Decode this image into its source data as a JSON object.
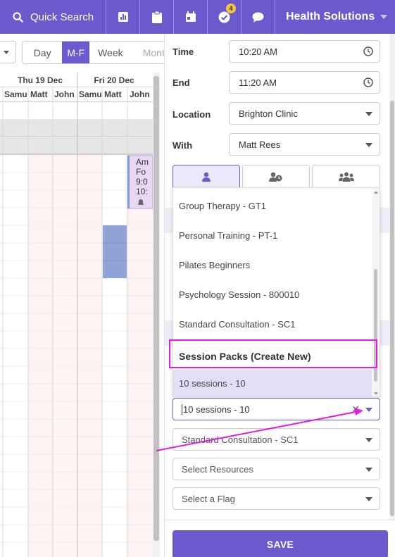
{
  "topbar": {
    "search_label": "Quick Search",
    "badge_count": "4",
    "org_name": "Health Solutions",
    "icons": [
      "search-icon",
      "chart-icon",
      "clipboard-icon",
      "calendar-icon",
      "check-circle-icon",
      "chat-icon"
    ]
  },
  "calendar": {
    "views": [
      "Day",
      "M-F",
      "Week",
      "Mont"
    ],
    "active_view": "M-F",
    "days": [
      {
        "label": "Thu 19 Dec",
        "practitioners": [
          "Samu",
          "Matt",
          "John"
        ]
      },
      {
        "label": "Fri 20 Dec",
        "practitioners": [
          "Samu",
          "Matt",
          "John"
        ]
      }
    ],
    "appointment": {
      "lines": [
        "Am",
        "Fo",
        "9:0",
        "10:"
      ]
    }
  },
  "form": {
    "time_label": "Time",
    "time_value": "10:20 AM",
    "end_label": "End",
    "end_value": "11:20 AM",
    "location_label": "Location",
    "location_value": "Brighton Clinic",
    "with_label": "With",
    "with_value": "Matt Rees",
    "mode_icons": [
      "single-person-icon",
      "person-clock-icon",
      "group-icon"
    ]
  },
  "dropdown": {
    "items": [
      "Group Therapy - GT1",
      "Personal Training - PT-1",
      "Pilates Beginners",
      "Psychology Session - 800010",
      "Standard Consultation - SC1"
    ],
    "group_header": "Session Packs (Create New)",
    "selected_item": "10 sessions - 10"
  },
  "selects": {
    "session_pack_value": "10 sessions - 10",
    "appointment_type_value": "Standard Consultation - SC1",
    "resources_placeholder": "Select Resources",
    "flag_placeholder": "Select a Flag"
  },
  "save_label": "SAVE",
  "colors": {
    "brand": "#6a5acd",
    "annotation": "#e21ce0",
    "selected_row": "#e2e0f7",
    "slot_highlight": "#8fa3d6"
  }
}
